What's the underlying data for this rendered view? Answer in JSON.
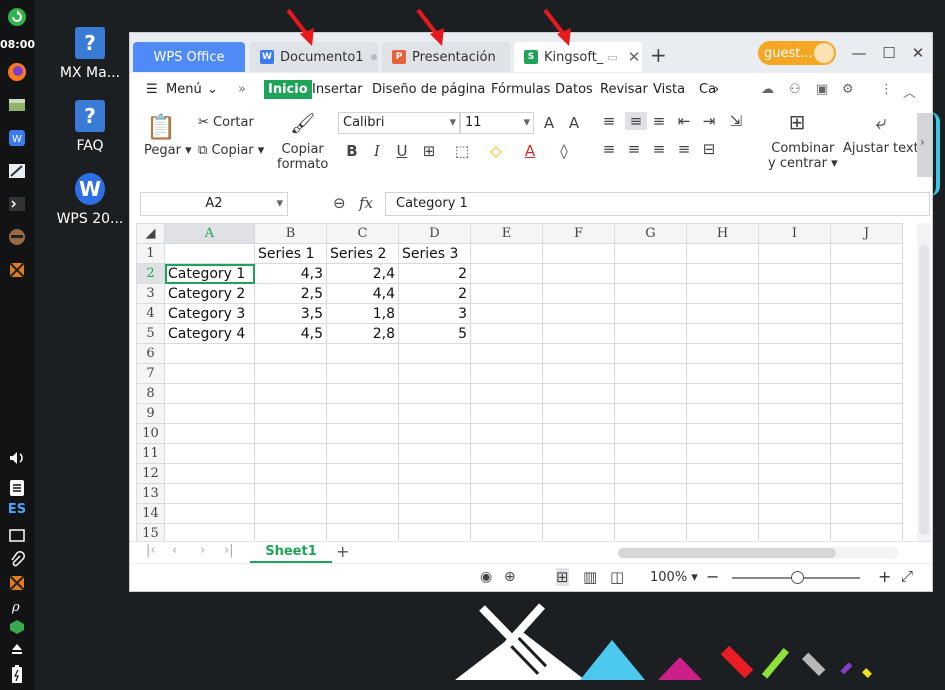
{
  "panel": {
    "clock": "08:00",
    "lang": "ES"
  },
  "desktop": {
    "icons": [
      {
        "label": "MX Ma...",
        "glyph": "?"
      },
      {
        "label": "FAQ",
        "glyph": "?"
      },
      {
        "label": "WPS 20...",
        "glyph": "W"
      }
    ]
  },
  "window": {
    "tabs": [
      {
        "label": "WPS Office"
      },
      {
        "label": "Documento1",
        "icon": "W"
      },
      {
        "label": "Presentación",
        "icon": "P"
      },
      {
        "label": "Kingsoft_",
        "icon": "S"
      }
    ],
    "new_tab": "+",
    "user": "guest...",
    "menu": {
      "menu_label": "Menú",
      "items": [
        "Inicio",
        "Insertar",
        "Diseño de página",
        "Fórmulas",
        "Datos",
        "Revisar",
        "Vista",
        "Ca"
      ]
    },
    "ribbon": {
      "cut": "Cortar",
      "paste": "Pegar",
      "copy": "Copiar",
      "format_painter_1": "Copiar",
      "format_painter_2": "formato",
      "font": "Calibri",
      "size": "11",
      "merge_1": "Combinar",
      "merge_2": "y centrar",
      "wrap": "Ajustar texto"
    },
    "formula_bar": {
      "namebox": "A2",
      "fx": "fx",
      "value": "Category 1"
    },
    "columns": [
      "A",
      "B",
      "C",
      "D",
      "E",
      "F",
      "G",
      "H",
      "I",
      "J"
    ],
    "rows": [
      [
        "",
        "Series 1",
        "Series 2",
        "Series 3"
      ],
      [
        "Category 1",
        "4,3",
        "2,4",
        "2"
      ],
      [
        "Category 2",
        "2,5",
        "4,4",
        "2"
      ],
      [
        "Category 3",
        "3,5",
        "1,8",
        "3"
      ],
      [
        "Category 4",
        "4,5",
        "2,8",
        "5"
      ],
      [],
      [],
      [],
      [],
      [],
      [],
      [],
      [],
      [],
      []
    ],
    "sheet": "Sheet1",
    "zoom": "100%"
  },
  "colors": {
    "accent_green": "#1fa35b",
    "tab_blue": "#4f8af7",
    "guest_orange": "#f5a623",
    "arrow_red": "#e8191b"
  }
}
